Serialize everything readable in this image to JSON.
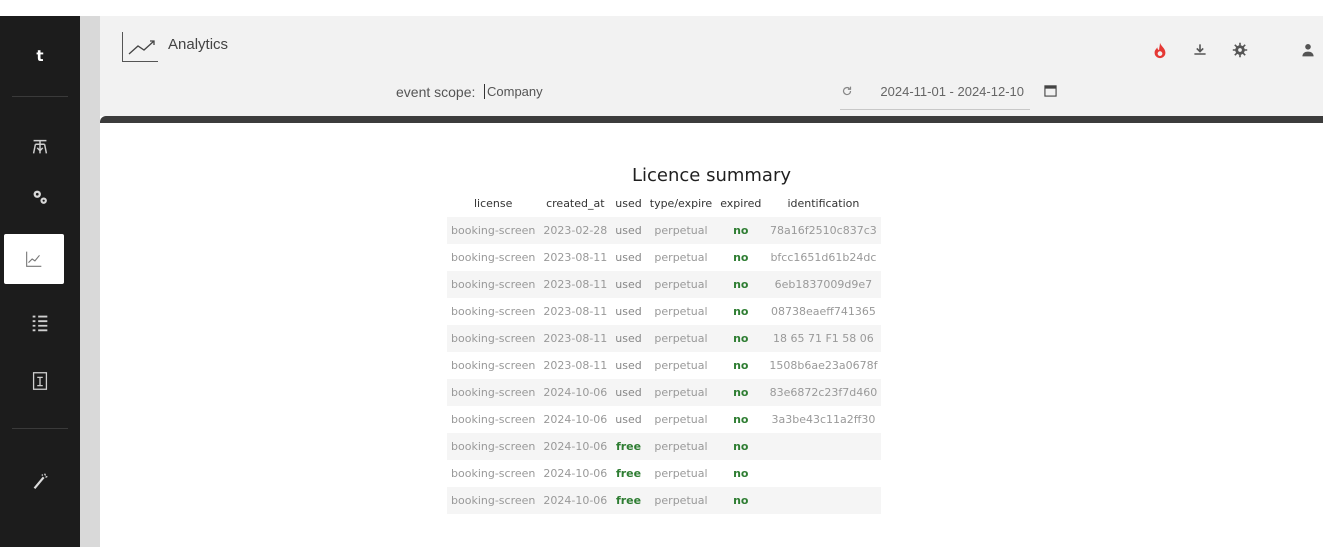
{
  "app": {
    "brand_letter": "t",
    "title": "Analytics"
  },
  "filters": {
    "scope_label": "event scope:",
    "scope_value": "Company",
    "date_range": "2024-11-01 - 2024-12-10"
  },
  "colors": {
    "sidebar_bg": "#1c1c1c",
    "accent_red": "#e53935",
    "ok_green": "#2e7d32"
  },
  "toolbar_icons": [
    "fire-icon",
    "download-icon",
    "gear-icon",
    "user-icon"
  ],
  "sidebar_icons": [
    "hierarchy-icon",
    "cogs-icon",
    "chart-line-icon",
    "list-icon",
    "text-field-icon",
    "wand-icon"
  ],
  "summary": {
    "title": "Licence summary",
    "columns": [
      "license",
      "created_at",
      "used",
      "type/expire",
      "expired",
      "identification"
    ],
    "rows": [
      [
        "booking-screen",
        "2023-02-28",
        "used",
        "perpetual",
        "no",
        "78a16f2510c837c3"
      ],
      [
        "booking-screen",
        "2023-08-11",
        "used",
        "perpetual",
        "no",
        "bfcc1651d61b24dc"
      ],
      [
        "booking-screen",
        "2023-08-11",
        "used",
        "perpetual",
        "no",
        "6eb1837009d9e7"
      ],
      [
        "booking-screen",
        "2023-08-11",
        "used",
        "perpetual",
        "no",
        "08738eaeff741365"
      ],
      [
        "booking-screen",
        "2023-08-11",
        "used",
        "perpetual",
        "no",
        "18 65 71 F1 58 06"
      ],
      [
        "booking-screen",
        "2023-08-11",
        "used",
        "perpetual",
        "no",
        "1508b6ae23a0678f"
      ],
      [
        "booking-screen",
        "2024-10-06",
        "used",
        "perpetual",
        "no",
        "83e6872c23f7d460"
      ],
      [
        "booking-screen",
        "2024-10-06",
        "used",
        "perpetual",
        "no",
        "3a3be43c11a2ff30"
      ],
      [
        "booking-screen",
        "2024-10-06",
        "free",
        "perpetual",
        "no",
        ""
      ],
      [
        "booking-screen",
        "2024-10-06",
        "free",
        "perpetual",
        "no",
        ""
      ],
      [
        "booking-screen",
        "2024-10-06",
        "free",
        "perpetual",
        "no",
        ""
      ]
    ]
  }
}
